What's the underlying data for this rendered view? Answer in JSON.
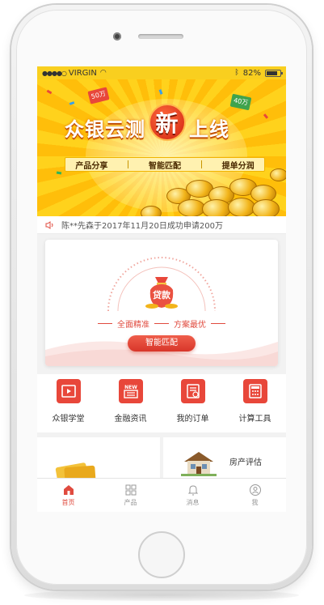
{
  "status_bar": {
    "carrier": "VIRGIN",
    "battery_percent": "82%",
    "battery_level": 0.82
  },
  "banner": {
    "title_part1": "众银云测",
    "title_highlight": "新",
    "title_part2": "上线",
    "tags": [
      "产品分享",
      "智能匹配",
      "提单分润"
    ],
    "red_packet_left": "50万",
    "red_packet_right": "40万"
  },
  "notice": {
    "text": "陈**先森于2017年11月20日成功申请200万"
  },
  "loan_card": {
    "bag_label": "贷款",
    "slogans": [
      "全面精准",
      "方案最优"
    ],
    "button_label": "智能匹配"
  },
  "quick_actions": [
    {
      "label": "众银学堂",
      "icon": "video-icon"
    },
    {
      "label": "金融资讯",
      "icon": "news-icon"
    },
    {
      "label": "我的订单",
      "icon": "order-icon"
    },
    {
      "label": "计算工具",
      "icon": "calculator-icon"
    }
  ],
  "promos": {
    "right_label": "房产评估"
  },
  "tab_bar": [
    {
      "label": "首页",
      "icon": "home-icon",
      "active": true
    },
    {
      "label": "产品",
      "icon": "grid-icon",
      "active": false
    },
    {
      "label": "消息",
      "icon": "bell-icon",
      "active": false
    },
    {
      "label": "我",
      "icon": "user-icon",
      "active": false
    }
  ],
  "colors": {
    "accent": "#e04b3f",
    "banner_yellow": "#ffc61a"
  }
}
